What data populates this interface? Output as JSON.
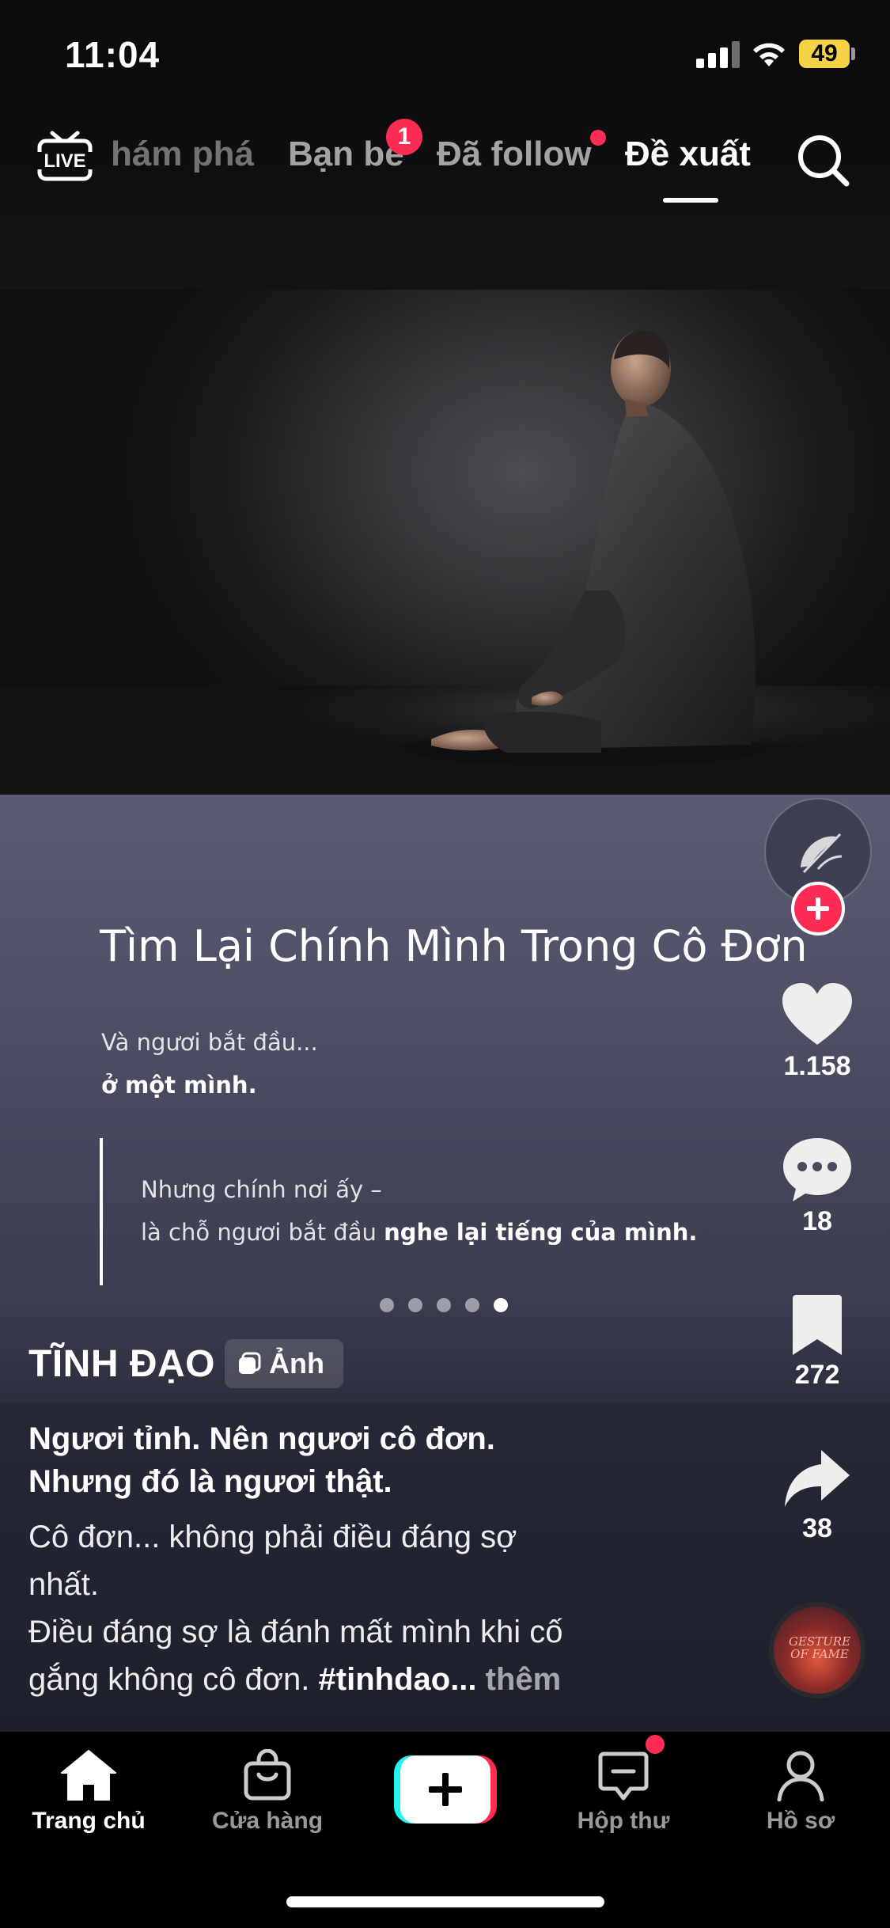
{
  "status_bar": {
    "time": "11:04",
    "battery": "49"
  },
  "top_nav": {
    "live_label": "LIVE",
    "tabs": [
      {
        "label": "hám phá"
      },
      {
        "label": "Bạn bè",
        "badge": "1"
      },
      {
        "label": "Đã follow",
        "dot": true
      },
      {
        "label": "Đề xuất",
        "active": true
      }
    ]
  },
  "post": {
    "slide": {
      "title": "Tìm Lại Chính Mình Trong Cô Đơn",
      "line1": "Và ngươi bắt đầu...",
      "line2": "ở một mình.",
      "quote1": "Nhưng chính nơi ấy –",
      "quote2_prefix": "là chỗ ngươi bắt đầu ",
      "quote2_bold": "nghe lại tiếng của mình.",
      "page_count": 5,
      "current_page": 5
    },
    "author": "TĨNH ĐẠO",
    "type_chip": "Ảnh",
    "caption_title_1": "Ngươi tỉnh. Nên ngươi cô đơn.",
    "caption_title_2": "Nhưng đó là ngươi thật.",
    "caption_1": "Cô đơn... không phải điều đáng sợ",
    "caption_2": "nhất.",
    "caption_3": "Điều đáng sợ là đánh mất mình khi cố",
    "caption_4_prefix": "gắng không cô đơn. ",
    "caption_4_tag": "#tinhdao",
    "caption_4_ellipsis": "...",
    "more_label": " thêm",
    "music_disc_text": "GESTURE OF FAME"
  },
  "actions": {
    "likes": "1.158",
    "comments": "18",
    "saves": "272",
    "shares": "38"
  },
  "tab_bar": {
    "items": [
      {
        "label": "Trang chủ",
        "active": true
      },
      {
        "label": "Cửa hàng"
      },
      {
        "label": ""
      },
      {
        "label": "Hộp thư"
      },
      {
        "label": "Hồ sơ"
      }
    ]
  },
  "colors": {
    "accent": "#fe2c55",
    "cyan": "#25f4ee",
    "battery": "#f5d246"
  }
}
